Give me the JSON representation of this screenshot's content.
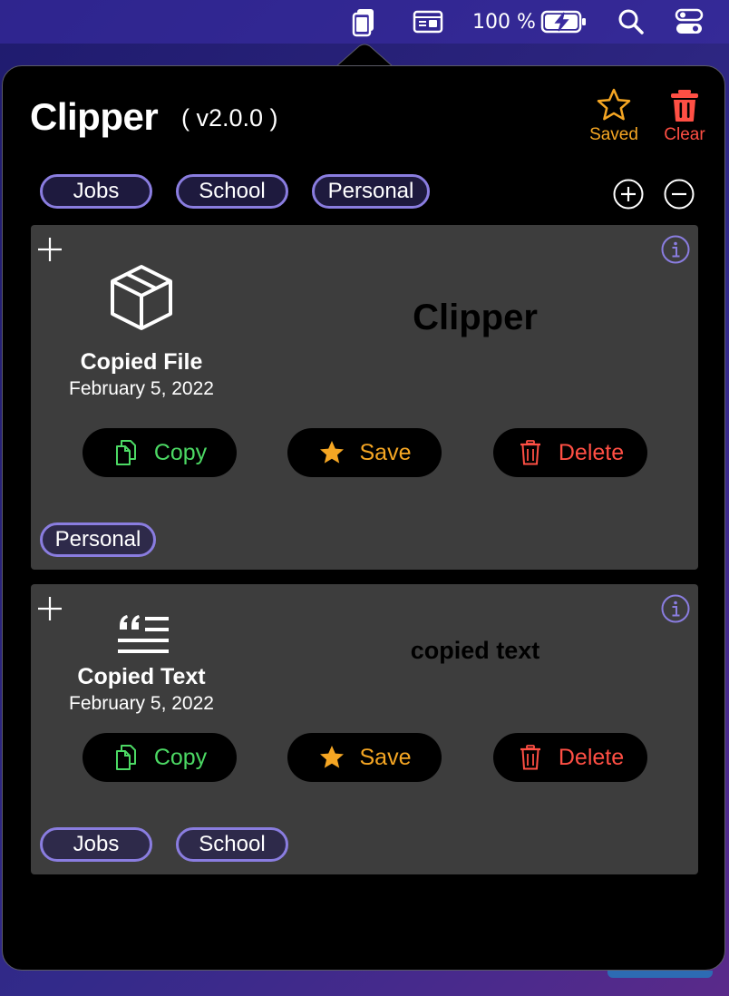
{
  "menubar": {
    "battery_text": "100 %",
    "icons": [
      "clipper-menubar-icon",
      "keyboard-viewer-icon",
      "battery-charging-icon",
      "spotlight-search-icon",
      "control-center-icon"
    ]
  },
  "header": {
    "title": "Clipper",
    "version": "( v2.0.0 )",
    "saved_label": "Saved",
    "clear_label": "Clear"
  },
  "tags": [
    "Jobs",
    "School",
    "Personal"
  ],
  "tag_controls": [
    "add-tag-icon",
    "remove-tag-icon"
  ],
  "colors": {
    "accent_purple": "#8a7de0",
    "copy_green": "#4cd964",
    "save_orange": "#f5a623",
    "delete_red": "#ff4f44",
    "card_bg": "#3d3d3d"
  },
  "clips": [
    {
      "type_label": "Copied File",
      "date": "February 5, 2022",
      "preview": "Clipper",
      "icon": "package-box-icon",
      "actions": {
        "copy": "Copy",
        "save": "Save",
        "delete": "Delete"
      },
      "tags": [
        "Personal"
      ]
    },
    {
      "type_label": "Copied Text",
      "date": "February 5, 2022",
      "preview": "copied text",
      "icon": "quote-text-icon",
      "actions": {
        "copy": "Copy",
        "save": "Save",
        "delete": "Delete"
      },
      "tags": [
        "Jobs",
        "School"
      ]
    }
  ]
}
